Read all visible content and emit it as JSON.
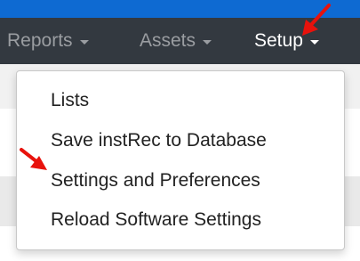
{
  "navbar": {
    "items": [
      {
        "label": "Reports"
      },
      {
        "label": "Assets"
      },
      {
        "label": "Setup"
      }
    ],
    "active": "Setup"
  },
  "dropdown": {
    "items": [
      {
        "label": "Lists"
      },
      {
        "label": "Save instRec to Database"
      },
      {
        "label": "Settings and Preferences"
      },
      {
        "label": "Reload Software Settings"
      }
    ]
  },
  "annotations": {
    "arrow_color": "#e8120c",
    "icons": [
      "red-arrow-icon",
      "red-arrow-icon"
    ]
  },
  "colors": {
    "navbar_bg": "#333940",
    "top_strip": "#0e6ad2",
    "nav_text_inactive": "#9a9da1",
    "nav_text_active": "#ffffff"
  }
}
